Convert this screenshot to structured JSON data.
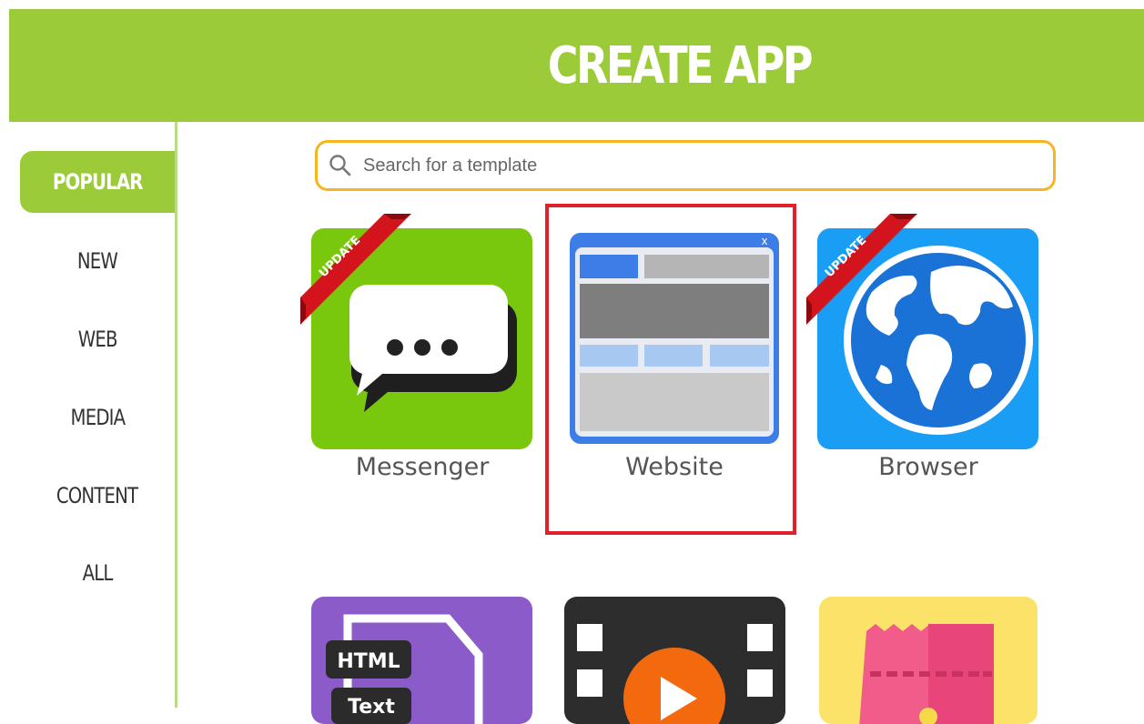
{
  "header": {
    "title": "CREATE APP"
  },
  "sidebar": {
    "items": [
      {
        "label": "POPULAR",
        "active": true
      },
      {
        "label": "NEW"
      },
      {
        "label": "WEB"
      },
      {
        "label": "MEDIA"
      },
      {
        "label": "CONTENT"
      },
      {
        "label": "ALL"
      }
    ]
  },
  "search": {
    "placeholder": "Search for a template",
    "icon": "search-icon"
  },
  "templates": [
    {
      "name": "Messenger",
      "badge": "UPDATE",
      "color": "#79c80e",
      "icon": "chat-bubble-icon"
    },
    {
      "name": "Website",
      "color": "#3d7de8",
      "icon": "website-layout-icon",
      "close_glyph": "x"
    },
    {
      "name": "Browser",
      "badge": "UPDATE",
      "color": "#1a9ef5",
      "icon": "globe-icon"
    },
    {
      "name": "",
      "color": "#8b5bc9",
      "icon": "html-file-icon",
      "tags": [
        "HTML",
        "Text"
      ]
    },
    {
      "name": "",
      "color": "#2d2d2d",
      "icon": "video-player-icon"
    },
    {
      "name": "",
      "color": "#fbe36a",
      "icon": "ticket-icon"
    }
  ],
  "colors": {
    "accent": "#9ccb39",
    "search_border": "#f5b622",
    "selection": "#e0202a",
    "ribbon": "#d4141c"
  }
}
